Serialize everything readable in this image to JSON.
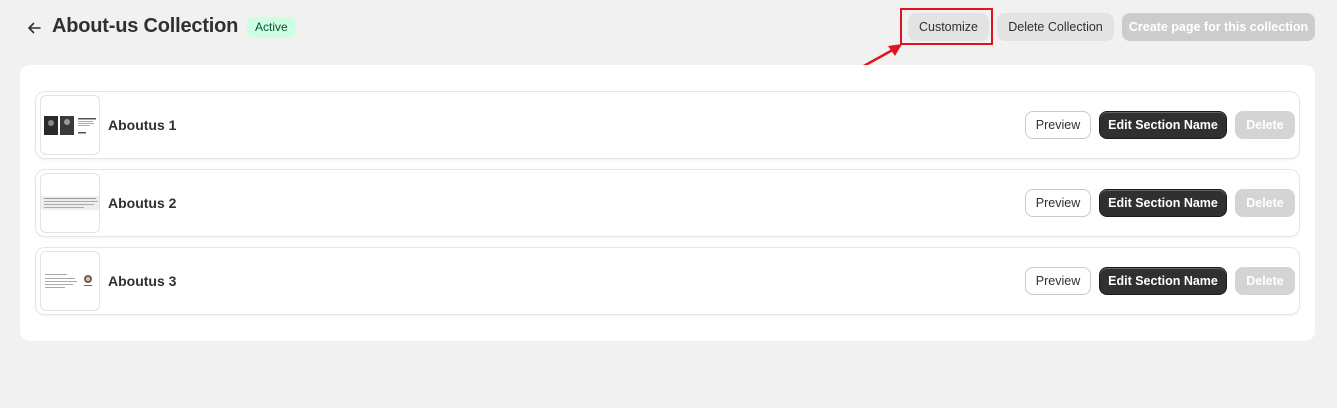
{
  "header": {
    "title": "About-us Collection",
    "status": "Active",
    "customize_label": "Customize",
    "delete_collection_label": "Delete Collection",
    "create_page_label": "Create page for this collection"
  },
  "sections": [
    {
      "name": "Aboutus 1",
      "preview_label": "Preview",
      "edit_label": "Edit Section Name",
      "delete_label": "Delete"
    },
    {
      "name": "Aboutus 2",
      "preview_label": "Preview",
      "edit_label": "Edit Section Name",
      "delete_label": "Delete"
    },
    {
      "name": "Aboutus 3",
      "preview_label": "Preview",
      "edit_label": "Edit Section Name",
      "delete_label": "Delete"
    }
  ],
  "icons": {
    "back": "arrow-left-icon"
  },
  "colors": {
    "highlight": "#e0141e",
    "badge_bg": "#cdfee1",
    "badge_text": "#0c5132",
    "primary_button": "#303030"
  }
}
